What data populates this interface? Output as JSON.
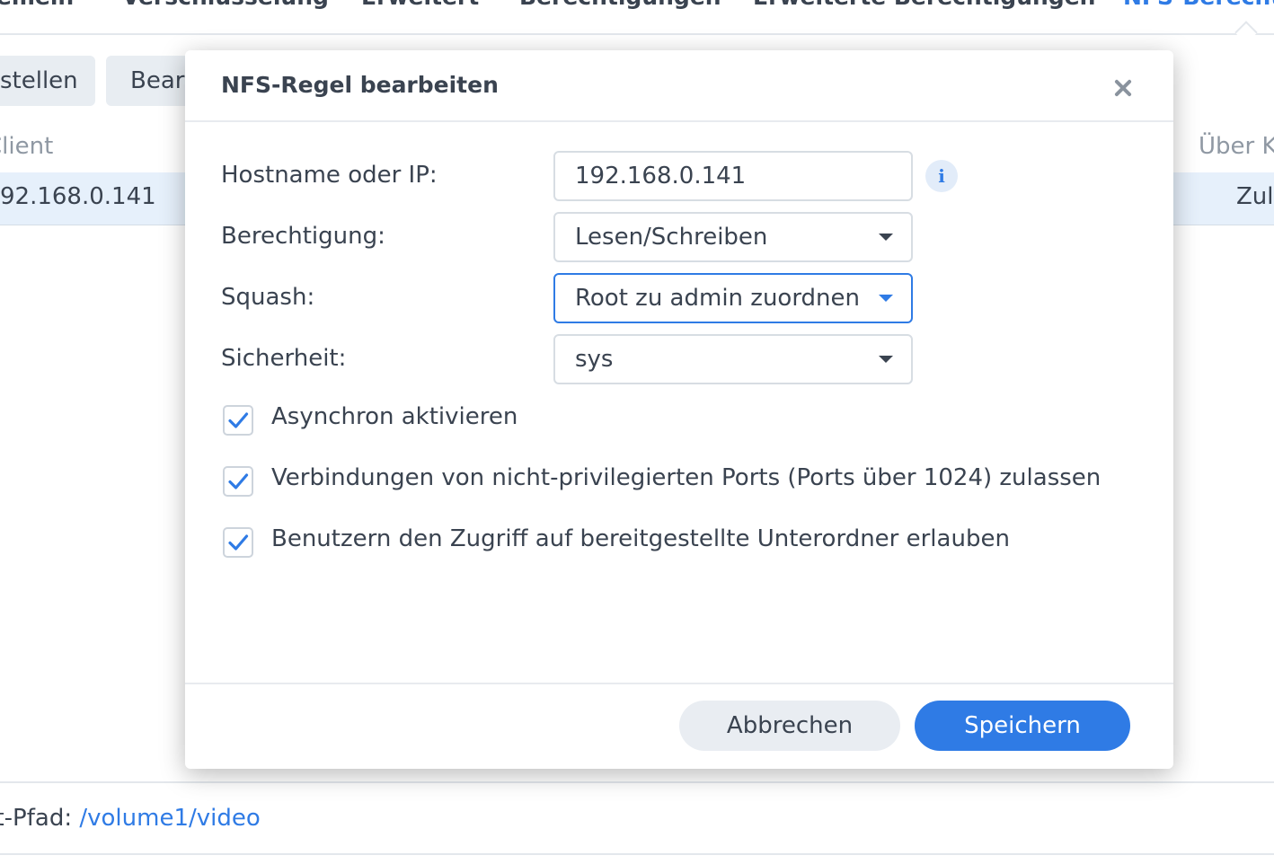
{
  "tabs": [
    {
      "label": "gemein"
    },
    {
      "label": "Verschlüsselung"
    },
    {
      "label": "Erweitert"
    },
    {
      "label": "Berechtigungen"
    },
    {
      "label": "Erweiterte Berechtigungen"
    },
    {
      "label": "NFS-Berecht",
      "active": true
    }
  ],
  "toolbar": {
    "create_label": "stellen",
    "edit_label": "Bear"
  },
  "grid": {
    "headers": [
      "Client",
      "Über K"
    ],
    "row": {
      "client": "92.168.0.141",
      "access": "Zul"
    }
  },
  "mount_path": {
    "label": "nt-Pfad:",
    "value": "/volume1/video"
  },
  "dialog": {
    "title": "NFS-Regel bearbeiten",
    "fields": {
      "hostname": {
        "label": "Hostname oder IP:",
        "value": "192.168.0.141"
      },
      "permission": {
        "label": "Berechtigung:",
        "value": "Lesen/Schreiben"
      },
      "squash": {
        "label": "Squash:",
        "value": "Root zu admin zuordnen"
      },
      "security": {
        "label": "Sicherheit:",
        "value": "sys"
      }
    },
    "info_icon": "i",
    "checkboxes": [
      {
        "label": "Asynchron aktivieren",
        "checked": true
      },
      {
        "label": "Verbindungen von nicht-privilegierten Ports (Ports über 1024) zulassen",
        "checked": true
      },
      {
        "label": "Benutzern den Zugriff auf bereitgestellte Unterordner erlauben",
        "checked": true
      }
    ],
    "buttons": {
      "cancel": "Abbrechen",
      "save": "Speichern"
    }
  },
  "colors": {
    "accent": "#2f7be5",
    "row_selected": "#e6f0fb",
    "button_grey": "#e9edf2"
  }
}
